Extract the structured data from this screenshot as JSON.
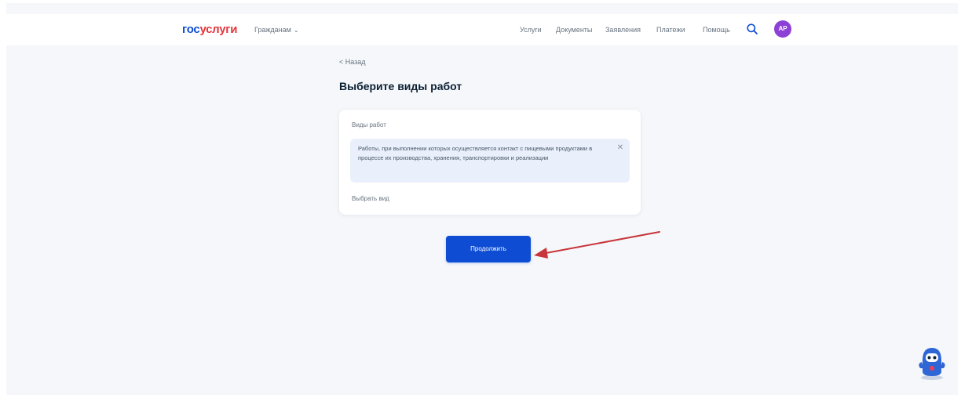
{
  "header": {
    "logo_part_a": "гос",
    "logo_part_b": "услуги",
    "role": "Гражданам",
    "nav": [
      "Услуги",
      "Документы",
      "Заявления",
      "Платежи",
      "Помощь"
    ],
    "avatar_initials": "АР",
    "accent_color": "#0d4cd3",
    "avatar_color": "#8d40d6"
  },
  "main": {
    "back_label": "< Назад",
    "title": "Выберите виды работ",
    "card": {
      "field_label": "Виды работ",
      "selected_item": "Работы, при выполнении которых осуществляется контакт с пищевыми продуктами в процессе их производства, хранения, транспортировки и реализации",
      "add_label": "Выбрать вид"
    },
    "continue_label": "Продолжить"
  },
  "icons": {
    "search": "search-icon",
    "close": "close-icon",
    "annotation": "red-arrow-icon",
    "assistant": "robot-assistant-icon"
  }
}
